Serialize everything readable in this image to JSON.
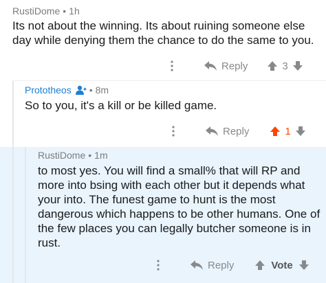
{
  "comments": [
    {
      "author": "RustiDome",
      "age": "1h",
      "body": "Its not about the winning. Its about ruining someone else day while denying them the chance to do the same to you.",
      "reply_label": "Reply",
      "score": "3"
    },
    {
      "author": "Prototheos",
      "age": "8m",
      "body": "So to you, it's a kill or be killed game.",
      "reply_label": "Reply",
      "score": "1"
    },
    {
      "author": "RustiDome",
      "age": "1m",
      "body": "to most yes. You will find a small% that will RP and more into bsing with each other but it depends what your into.  The funest game to hunt is the most dangerous which happens to be other humans. One of the few places you can legally butcher someone is in rust.",
      "reply_label": "Reply",
      "vote_label": "Vote"
    }
  ],
  "meta_separator": "•",
  "colors": {
    "highlight_background": "#e9f4fd",
    "upvote_active": "#ff4500",
    "author_link": "#1b7fd6"
  }
}
